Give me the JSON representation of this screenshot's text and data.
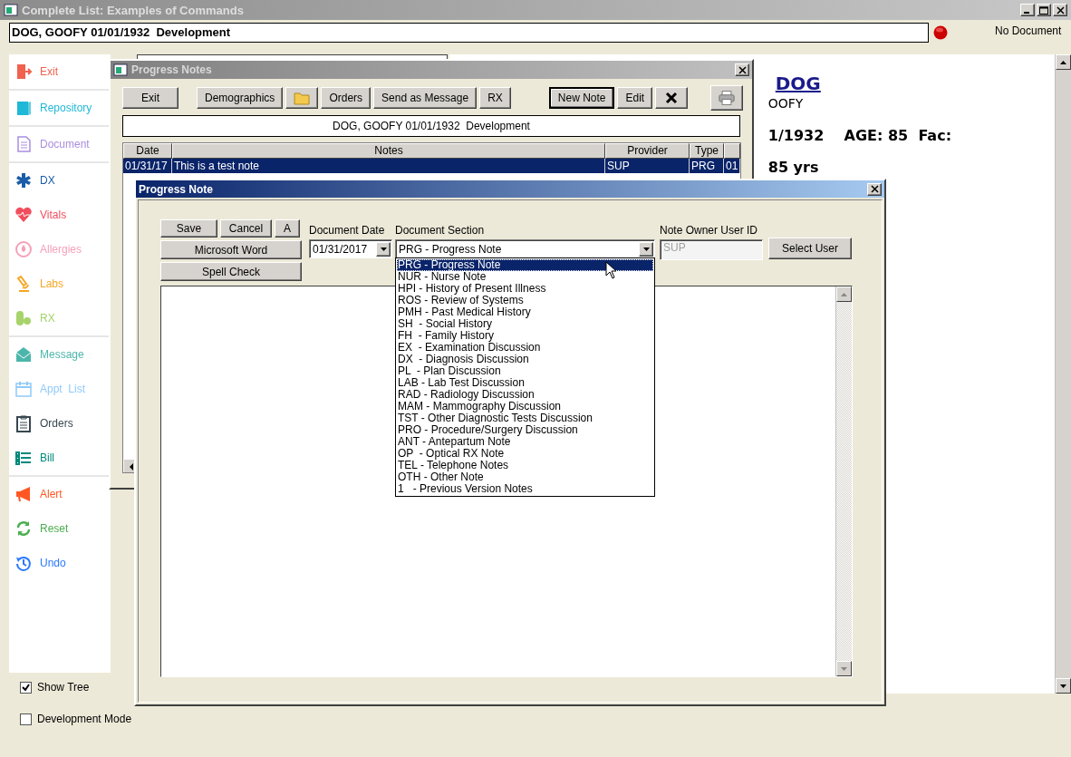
{
  "window": {
    "title": "Complete List: Examples of Commands"
  },
  "patient_bar": {
    "value": "DOG, GOOFY 01/01/1932  Development",
    "document_status": "No Document"
  },
  "sidebar": {
    "groups": [
      {
        "items": [
          {
            "kind": "exit",
            "label": "Exit",
            "color": "#f0614e"
          }
        ]
      },
      {
        "items": [
          {
            "kind": "repository",
            "label": "Repository",
            "color": "#1fb8d6"
          }
        ]
      },
      {
        "items": [
          {
            "kind": "document",
            "label": "Document",
            "color": "#a98ee0"
          }
        ]
      },
      {
        "items": [
          {
            "kind": "dx",
            "label": "DX",
            "color": "#1a5ca8"
          },
          {
            "kind": "vitals",
            "label": "Vitals",
            "color": "#f04e5e"
          },
          {
            "kind": "allergies",
            "label": "Allergies",
            "color": "#f5a0b8"
          },
          {
            "kind": "labs",
            "label": "Labs",
            "color": "#f5a623"
          },
          {
            "kind": "rx",
            "label": "RX",
            "color": "#a6d36a"
          }
        ]
      },
      {
        "items": [
          {
            "kind": "message",
            "label": "Message",
            "color": "#4db6ac"
          },
          {
            "kind": "calendar",
            "label": "Appt  List",
            "color": "#90caf9"
          },
          {
            "kind": "orders",
            "label": "Orders",
            "color": "#37474f"
          },
          {
            "kind": "bill",
            "label": "Bill",
            "color": "#00897b"
          }
        ]
      },
      {
        "items": [
          {
            "kind": "alert",
            "label": "Alert",
            "color": "#ff5722"
          },
          {
            "kind": "reset",
            "label": "Reset",
            "color": "#4caf50"
          },
          {
            "kind": "undo",
            "label": "Undo",
            "color": "#2979ff"
          }
        ]
      }
    ]
  },
  "options": [
    {
      "label": "Show Tree",
      "checked": true
    },
    {
      "label": "Development Mode",
      "checked": false
    }
  ],
  "document_view": {
    "heading": "DOG",
    "lines": [
      {
        "text": "OOFY",
        "bold": false
      },
      {
        "text": "1/1932    AGE: 85  Fac:",
        "bold": true
      },
      {
        "text": "85 yrs",
        "bold": true
      }
    ]
  },
  "progress_notes": {
    "title": "Progress Notes",
    "toolbar": [
      {
        "buttons": [
          {
            "kind": "text",
            "label": "Exit",
            "default": false
          }
        ]
      },
      {
        "buttons": [
          {
            "kind": "text",
            "label": "Demographics",
            "default": false
          },
          {
            "kind": "folder",
            "default": false
          },
          {
            "kind": "text",
            "label": "Orders",
            "default": false
          },
          {
            "kind": "text",
            "label": "Send as Message",
            "default": false
          },
          {
            "kind": "text",
            "label": "RX",
            "default": false
          }
        ]
      },
      {
        "buttons": [
          {
            "kind": "text",
            "label": "New Note",
            "default": true
          },
          {
            "kind": "text",
            "label": "Edit",
            "default": false
          },
          {
            "kind": "delete",
            "default": false
          }
        ]
      },
      {
        "buttons": [
          {
            "kind": "print",
            "default": false
          }
        ]
      }
    ],
    "patient_label": "DOG, GOOFY 01/01/1932  Development",
    "table": {
      "columns": [
        "Date",
        "Notes",
        "Provider",
        "Type"
      ],
      "rows": [
        {
          "cells": [
            "01/31/17",
            "This is a test note",
            "SUP",
            "PRG",
            "01"
          ],
          "selected": true
        }
      ]
    }
  },
  "progress_note": {
    "title": "Progress Note",
    "buttons": [
      {
        "label": "Save"
      },
      {
        "label": "Cancel"
      },
      {
        "label": "A"
      },
      {
        "label": "Microsoft Word"
      },
      {
        "label": "Spell Check"
      }
    ],
    "document_date": {
      "label": "Document Date",
      "value": "01/31/2017"
    },
    "document_section": {
      "label": "Document Section",
      "value": "PRG - Progress Note",
      "expanded": true,
      "options": [
        {
          "label": "PRG - Progress Note",
          "selected": true
        },
        {
          "label": "NUR - Nurse Note",
          "selected": false
        },
        {
          "label": "HPI - History of Present Illness",
          "selected": false
        },
        {
          "label": "ROS - Review of Systems",
          "selected": false
        },
        {
          "label": "PMH - Past Medical History",
          "selected": false
        },
        {
          "label": "SH  - Social History",
          "selected": false
        },
        {
          "label": "FH  - Family History",
          "selected": false
        },
        {
          "label": "EX  - Examination Discussion",
          "selected": false
        },
        {
          "label": "DX  - Diagnosis Discussion",
          "selected": false
        },
        {
          "label": "PL  - Plan Discussion",
          "selected": false
        },
        {
          "label": "LAB - Lab Test Discussion",
          "selected": false
        },
        {
          "label": "RAD - Radiology Discussion",
          "selected": false
        },
        {
          "label": "MAM - Mammography Discussion",
          "selected": false
        },
        {
          "label": "TST - Other Diagnostic Tests Discussion",
          "selected": false
        },
        {
          "label": "PRO - Procedure/Surgery Discussion",
          "selected": false
        },
        {
          "label": "ANT - Antepartum Note",
          "selected": false
        },
        {
          "label": "OP  - Optical RX Note",
          "selected": false
        },
        {
          "label": "TEL - Telephone Notes",
          "selected": false
        },
        {
          "label": "OTH - Other Note",
          "selected": false
        },
        {
          "label": "1   - Previous Version Notes",
          "selected": false
        }
      ]
    },
    "note_owner": {
      "label": "Note Owner User ID",
      "value": "SUP",
      "disabled": true
    },
    "select_user": {
      "label": "Select User"
    }
  }
}
